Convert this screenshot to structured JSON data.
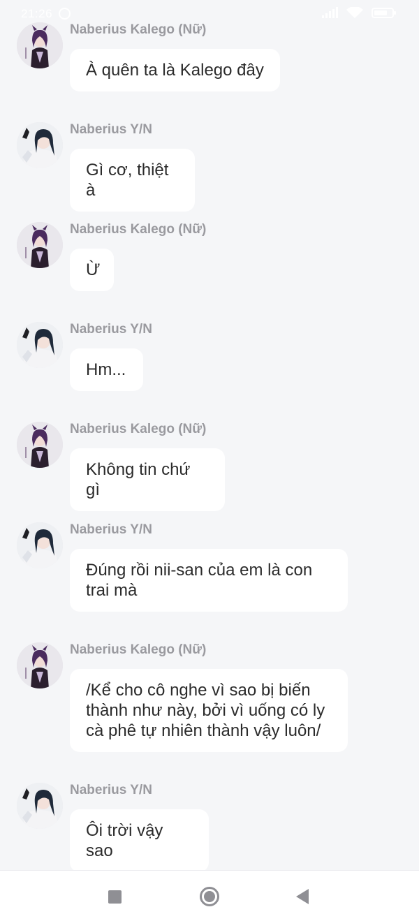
{
  "status_bar": {
    "time": "21:26"
  },
  "senders": {
    "kalego": "Naberius Kalego (Nữ)",
    "yn": "Naberius Y/N"
  },
  "messages": [
    {
      "sender": "Naberius Kalego (Nữ)",
      "avatar": "kalego-avatar",
      "text": "À quên ta là Kalego đây"
    },
    {
      "sender": "Naberius Y/N",
      "avatar": "yn-avatar",
      "text": "Gì cơ, thiệt à"
    },
    {
      "sender": "Naberius Kalego (Nữ)",
      "avatar": "kalego-avatar",
      "text": "Ừ"
    },
    {
      "sender": "Naberius Y/N",
      "avatar": "yn-avatar",
      "text": "Hm..."
    },
    {
      "sender": "Naberius Kalego (Nữ)",
      "avatar": "kalego-avatar",
      "text": "Không tin chứ gì"
    },
    {
      "sender": "Naberius Y/N",
      "avatar": "yn-avatar",
      "text": "Đúng rồi nii-san của em là con trai mà"
    },
    {
      "sender": "Naberius Kalego (Nữ)",
      "avatar": "kalego-avatar",
      "text": "/Kể cho cô nghe vì sao bị biến thành như này, bởi vì uống có ly cà phê tự nhiên thành vậy luôn/"
    },
    {
      "sender": "Naberius Y/N",
      "avatar": "yn-avatar",
      "text": "Ôi trời vậy sao"
    }
  ],
  "nav_bar": {
    "buttons": [
      "recents-icon",
      "home-icon",
      "back-icon"
    ]
  },
  "colors": {
    "background": "#f5f6f8",
    "bubble": "#ffffff",
    "sender_text": "#9a9a9f",
    "message_text": "#2b2b2b",
    "nav_icon": "#8f8f94"
  }
}
